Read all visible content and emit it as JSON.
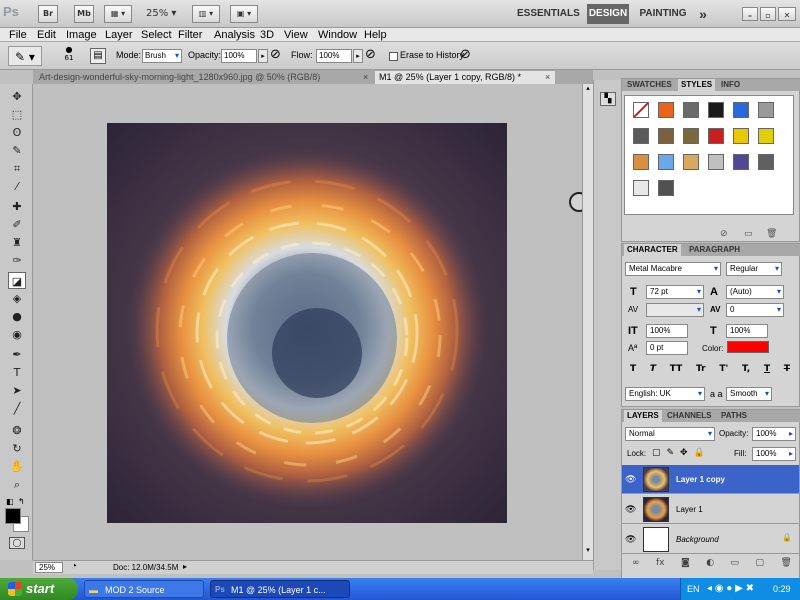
{
  "appbar": {
    "logo": "Ps",
    "br": "Br",
    "mb": "Mb",
    "zoom": "25%",
    "workspaces": [
      "ESSENTIALS",
      "DESIGN",
      "PAINTING"
    ],
    "more": "»"
  },
  "menu": [
    "File",
    "Edit",
    "Image",
    "Layer",
    "Select",
    "Filter",
    "Analysis",
    "3D",
    "View",
    "Window",
    "Help"
  ],
  "options": {
    "brush_size": "61",
    "mode_label": "Mode:",
    "mode_value": "Brush",
    "opacity_label": "Opacity:",
    "opacity_value": "100%",
    "flow_label": "Flow:",
    "flow_value": "100%",
    "erase_history": "Erase to History"
  },
  "tabs": [
    {
      "label": "Art-design-wonderful-sky-morning-light_1280x960.jpg @ 50% (RGB/8)",
      "close": "×"
    },
    {
      "label": "M1 @ 25% (Layer 1 copy, RGB/8) *",
      "close": "×"
    }
  ],
  "status": {
    "zoom": "25%",
    "doc": "Doc: 12.0M/34.5M"
  },
  "swatches_panel": {
    "tabs": [
      "SWATCHES",
      "STYLES",
      "INFO"
    ],
    "styles": [
      "#ffffff",
      "#e8651c",
      "#6a6a6a",
      "#1a1a1a",
      "#2a6ad8",
      "#9a9a9a",
      "#5a5a5a",
      "#7a6040",
      "#7a6a3a",
      "#c82020",
      "#e8c800",
      "#e0d000",
      "#d89040",
      "#6aa8e8",
      "#d8a860",
      "#c0c0c0",
      "#504890",
      "#606060",
      "#e8e8e8",
      "#505050"
    ]
  },
  "character_panel": {
    "tabs": [
      "CHARACTER",
      "PARAGRAPH"
    ],
    "font": "Metal Macabre",
    "style": "Regular",
    "size": "72 pt",
    "leading": "(Auto)",
    "kerning": "",
    "tracking": "0",
    "vscale": "100%",
    "hscale": "100%",
    "baseline": "0 pt",
    "color_label": "Color:",
    "color": "#ff0000",
    "language": "English: UK",
    "aa_label": "a a",
    "aa": "Smooth",
    "typebtns": [
      "T",
      "T",
      "TT",
      "Tr",
      "T'",
      "T,",
      "T",
      "T"
    ]
  },
  "layers_panel": {
    "tabs": [
      "LAYERS",
      "CHANNELS",
      "PATHS"
    ],
    "blend": "Normal",
    "opacity_label": "Opacity:",
    "opacity": "100%",
    "lock_label": "Lock:",
    "fill_label": "Fill:",
    "fill": "100%",
    "layers": [
      {
        "name": "Layer 1 copy",
        "selected": true
      },
      {
        "name": "Layer 1",
        "selected": false
      },
      {
        "name": "Background",
        "selected": false
      }
    ]
  },
  "taskbar": {
    "start": "start",
    "items": [
      "MOD 2 Source",
      "M1 @ 25% (Layer 1 c..."
    ],
    "lang": "EN",
    "clock": "0:29"
  }
}
